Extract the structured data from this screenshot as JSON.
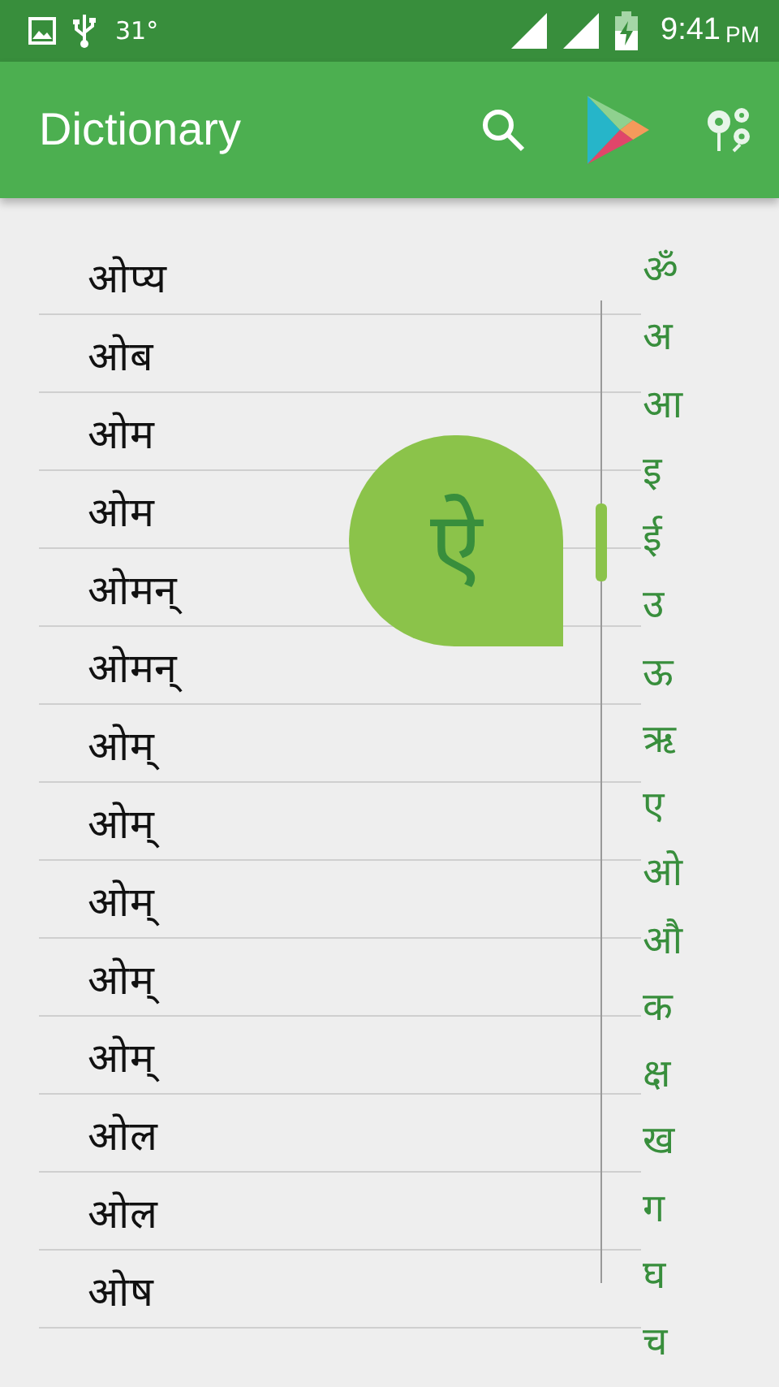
{
  "status_bar": {
    "temperature": "31°",
    "time": "9:41",
    "ampm": "PM"
  },
  "app_bar": {
    "title": "Dictionary"
  },
  "words": [
    "ओप्य",
    "ओब",
    "ओम",
    "ओम",
    "ओमन्",
    "ओमन्",
    "ओम्",
    "ओम्",
    "ओम्",
    "ओम्",
    "ओम्",
    "ओल",
    "ओल",
    "ओष"
  ],
  "index": [
    "ॐ",
    "अ",
    "आ",
    "इ",
    "ई",
    "उ",
    "ऊ",
    "ऋ",
    "ए",
    "ओ",
    "औ",
    "क",
    "क्ष",
    "ख",
    "ग",
    "घ",
    "च"
  ],
  "bubble": {
    "letter": "ऐ"
  }
}
